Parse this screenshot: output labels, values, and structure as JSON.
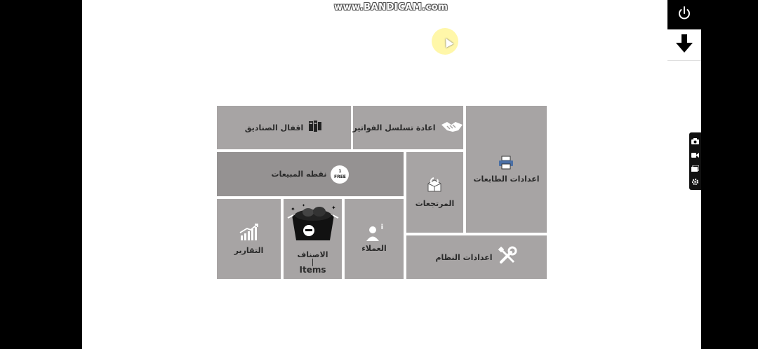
{
  "watermark": "www.BANDICAM.com",
  "menu": {
    "close_boxes": "اقفال الصناديق",
    "reset_invoice_sequence": "اعادة تسلسل الفواتير",
    "printer_settings": "اعدادات الطابعات",
    "point_of_sale": "نقطه المبيعات",
    "free_badge_num": "1",
    "free_badge_text": "FREE",
    "returns": "المرتجعات",
    "reports": "التقارير",
    "items_ar": "الاصناف",
    "items_en": "Items",
    "items_sep": "|",
    "customers": "العملاء",
    "customers_info": "i",
    "system_settings": "اعدادات النظام"
  },
  "icons": {
    "power": "power-icon",
    "download": "arrow-down-icon",
    "camera": "camera-icon",
    "video": "video-icon",
    "windows": "windows-icon",
    "settings": "gear-icon"
  }
}
